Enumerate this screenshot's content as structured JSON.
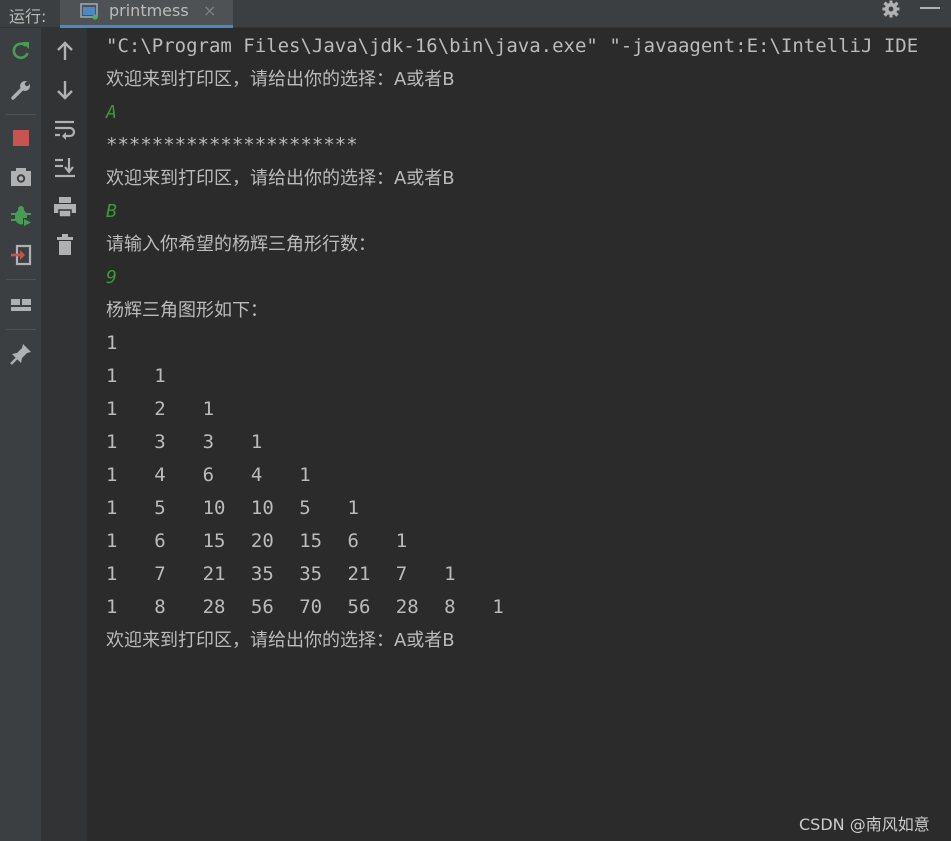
{
  "topbar": {
    "run_label": "运行:",
    "tab_label": "printmess",
    "tab_close": "×",
    "icons": [
      "run-config-icon",
      "settings-icon",
      "minimize-icon"
    ]
  },
  "toolbar_left": {
    "icons": [
      "rerun-icon",
      "wrench-icon",
      "stop-icon",
      "camera-icon",
      "debug-icon",
      "exit-icon",
      "layout-icon",
      "pin-icon"
    ]
  },
  "toolbar_right": {
    "icons": [
      "arrow-up-icon",
      "arrow-down-icon",
      "soft-wrap-icon",
      "scroll-to-end-icon",
      "print-icon",
      "trash-icon"
    ]
  },
  "console": {
    "command": "\"C:\\Program Files\\Java\\jdk-16\\bin\\java.exe\" \"-javaagent:E:\\IntelliJ IDE",
    "prompt1": "欢迎来到打印区，请给出你的选择：A或者B",
    "input1": "A",
    "stars": "**********************",
    "prompt2": "欢迎来到打印区，请给出你的选择：A或者B",
    "input2": "B",
    "rows_prompt": "请输入你希望的杨辉三角形行数：",
    "input3": "9",
    "triangle_title": "杨辉三角图形如下：",
    "triangle": [
      [
        "1"
      ],
      [
        "1",
        "1"
      ],
      [
        "1",
        "2",
        "1"
      ],
      [
        "1",
        "3",
        "3",
        "1"
      ],
      [
        "1",
        "4",
        "6",
        "4",
        "1"
      ],
      [
        "1",
        "5",
        "10",
        "10",
        "5",
        "1"
      ],
      [
        "1",
        "6",
        "15",
        "20",
        "15",
        "6",
        "1"
      ],
      [
        "1",
        "7",
        "21",
        "35",
        "35",
        "21",
        "7",
        "1"
      ],
      [
        "1",
        "8",
        "28",
        "56",
        "70",
        "56",
        "28",
        "8",
        "1"
      ]
    ],
    "prompt3": "欢迎来到打印区，请给出你的选择：A或者B"
  },
  "watermark": "CSDN @南风如意",
  "colors": {
    "background": "#2b2b2b",
    "text": "#bbbbbb",
    "user_input": "#3b9a36",
    "tab_underline": "#4a88c7",
    "stop": "#c75450",
    "rerun": "#499c54"
  }
}
